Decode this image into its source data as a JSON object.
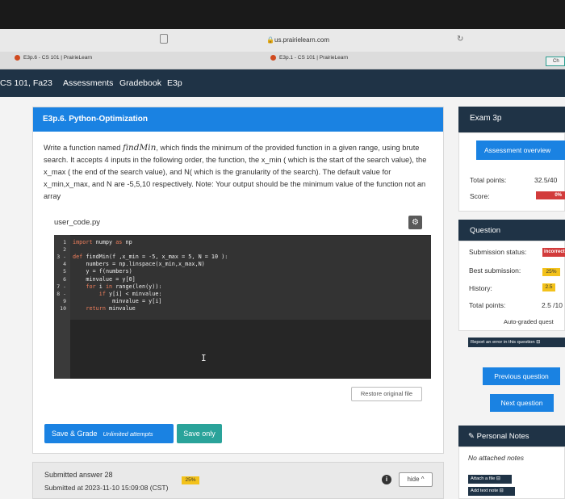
{
  "browser": {
    "url": "us.prairielearn.com",
    "tabs": [
      {
        "label": "E3p.6 - CS 101 | PrairieLearn"
      },
      {
        "label": "E3p.1 - CS 101 | PrairieLearn"
      },
      {
        "label": "Ch"
      }
    ]
  },
  "nav": {
    "course": "CS 101, Fa23",
    "assessments": "Assessments",
    "gradebook": "Gradebook",
    "current": "E3p"
  },
  "question": {
    "title": "E3p.6. Python-Optimization",
    "prompt_pre": "Write a function named ",
    "prompt_fn": "findMin",
    "prompt_post": ", which finds the minimum of the provided function in a given range, using brute search. It accepts 4 inputs in the following order, the function, the x_min ( which is the start of the search value), the x_max ( the end of the search value), and N( which is the granularity of the search). The default value for x_min,x_max, and N are -5,5,10 respectively. Note: Your output should be the minimum value of the function not an array",
    "filename": "user_code.py",
    "restore_label": "Restore original file",
    "code_lines": [
      {
        "n": "1",
        "text": "import numpy as np"
      },
      {
        "n": "2",
        "text": ""
      },
      {
        "n": "3 -",
        "text": "def findMin(f ,x_min = -5, x_max = 5, N = 10 ):"
      },
      {
        "n": "4",
        "text": "    numbers = np.linspace(x_min,x_max,N)"
      },
      {
        "n": "5",
        "text": "    y = f(numbers)"
      },
      {
        "n": "6",
        "text": "    minvalue = y[0]"
      },
      {
        "n": "7 -",
        "text": "    for i in range(len(y)):"
      },
      {
        "n": "8 -",
        "text": "        if y[i] < minvalue:"
      },
      {
        "n": "9",
        "text": "            minvalue = y[i]"
      },
      {
        "n": "10",
        "text": "    return minvalue"
      }
    ]
  },
  "actions": {
    "save_grade": "Save & Grade",
    "unlimited": "Unlimited attempts",
    "save_only": "Save only"
  },
  "submission": {
    "line1": "Submitted answer 28",
    "line2": "Submitted at 2023-11-10 15:09:08 (CST)",
    "badge": "25%",
    "hide_label": "hide ^"
  },
  "sidebar": {
    "exam_title": "Exam 3p",
    "assessment_overview": "Assessment overview",
    "total_points_label": "Total points:",
    "total_points_value": "32.5/40",
    "score_label": "Score:",
    "score_value": "0%",
    "question_title": "Question",
    "submission_status_label": "Submission status:",
    "submission_status_value": "incorrect",
    "best_submission_label": "Best submission:",
    "best_submission_value": "25%",
    "history_label": "History:",
    "history_value": "2.5",
    "q_total_points_label": "Total points:",
    "q_total_points_value": "2.5 /10",
    "auto_graded": "Auto-graded quest",
    "report_error": "Report an error in this question",
    "previous_question": "Previous question",
    "next_question": "Next question",
    "personal_notes": "Personal Notes",
    "no_notes": "No attached notes",
    "attach_file": "Attach a file",
    "add_text_note": "Add text note"
  }
}
